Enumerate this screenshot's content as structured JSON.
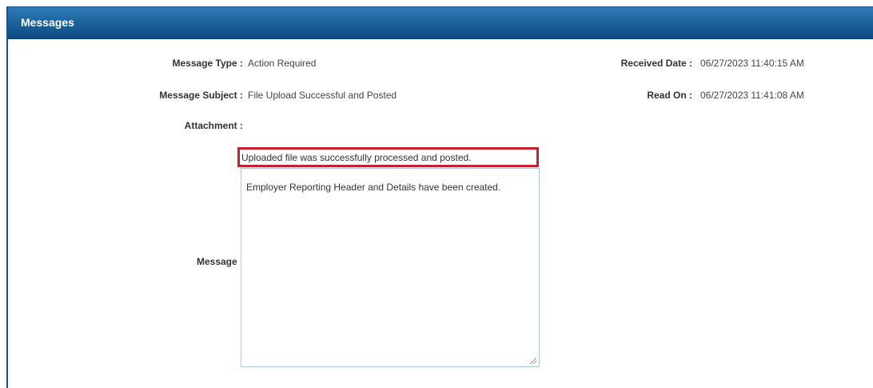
{
  "panel": {
    "title": "Messages"
  },
  "fields": {
    "message_type_label": "Message Type :",
    "message_type_value": "Action Required",
    "message_subject_label": "Message Subject :",
    "message_subject_value": "File Upload Successful and Posted",
    "attachment_label": "Attachment :",
    "message_label": "Message :",
    "received_date_label": "Received Date :",
    "received_date_value": "06/27/2023 11:40:15 AM",
    "read_on_label": "Read On :",
    "read_on_value": "06/27/2023 11:41:08 AM"
  },
  "message": {
    "line1": "Uploaded file was successfully processed and posted.",
    "line2": "Employer Reporting Header and Details have been created."
  },
  "colors": {
    "header_blue": "#1b5f99",
    "highlight_red": "#c8202a"
  }
}
